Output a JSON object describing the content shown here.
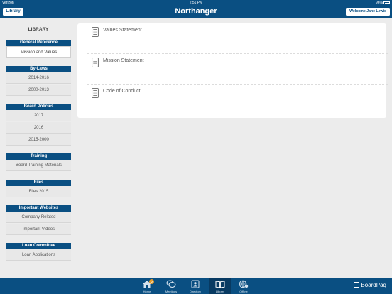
{
  "status_bar": {
    "carrier": "Verizon",
    "time": "2:51 PM",
    "battery": "96%"
  },
  "nav": {
    "library_button": "Library",
    "title": "Northanger",
    "welcome_button": "Welcome Jane Lewis"
  },
  "sidebar": {
    "heading": "LIBRARY",
    "sections": [
      {
        "header": "General Reference",
        "items": [
          "Mission and Values"
        ]
      },
      {
        "header": "By-Laws",
        "items": [
          "2014-2016",
          "2000-2013"
        ]
      },
      {
        "header": "Board Policies",
        "items": [
          "2017",
          "2016",
          "2015-2000"
        ]
      },
      {
        "header": "Training",
        "items": [
          "Board Training Materials"
        ]
      },
      {
        "header": "Files",
        "items": [
          "Files 2015"
        ]
      },
      {
        "header": "Important Websites",
        "items": [
          "Company Related",
          "Important Videos"
        ]
      },
      {
        "header": "Loan Committee",
        "items": [
          "Loan Applications"
        ]
      }
    ],
    "selected": "Mission and Values"
  },
  "documents": [
    "Values Statement",
    "Mission Statement",
    "Code of Conduct"
  ],
  "tabbar": {
    "tabs": [
      {
        "label": "Home",
        "icon": "home-icon",
        "badge": "0"
      },
      {
        "label": "Meetings",
        "icon": "meetings-icon"
      },
      {
        "label": "Directory",
        "icon": "directory-icon"
      },
      {
        "label": "Library",
        "icon": "library-icon",
        "active": true
      },
      {
        "label": "Offline",
        "icon": "offline-icon"
      }
    ],
    "brand": "BoardPaq"
  },
  "colors": {
    "primary": "#0a4f82",
    "active_tab": "#083a62",
    "badge": "#e39a2b",
    "background": "#ececec"
  }
}
